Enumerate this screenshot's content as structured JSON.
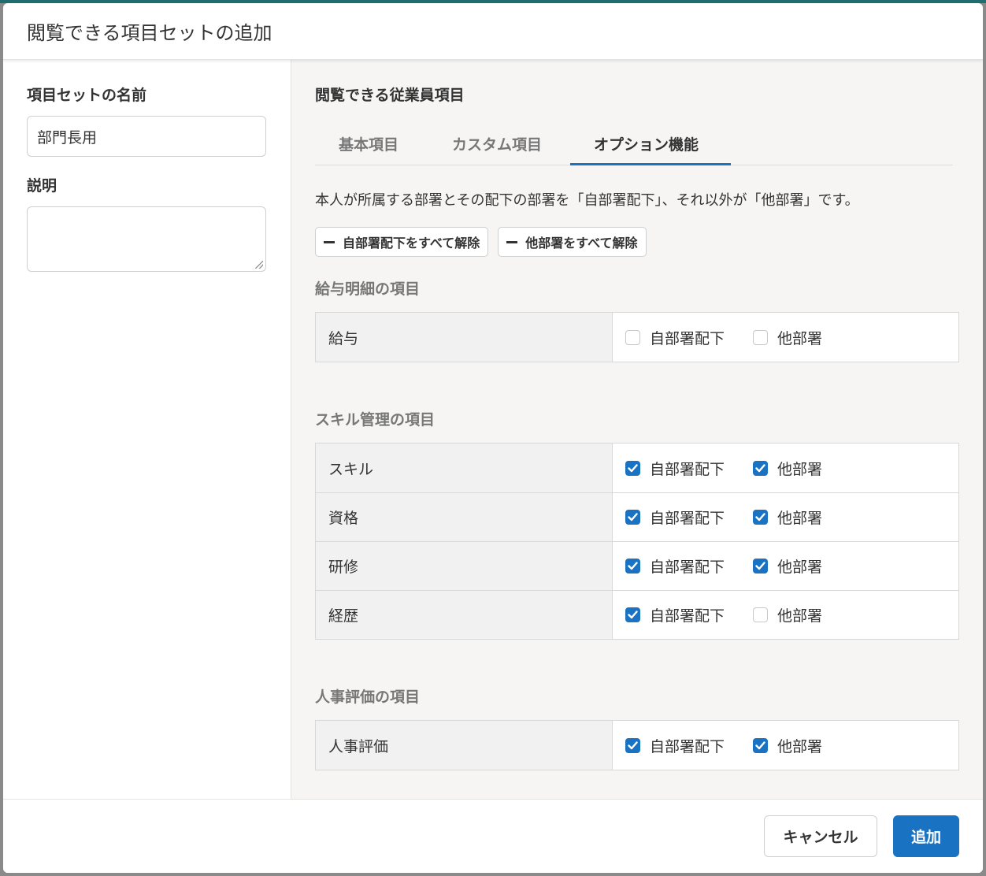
{
  "modal": {
    "title": "閲覧できる項目セットの追加"
  },
  "left": {
    "name_label": "項目セットの名前",
    "name_value": "部門長用",
    "desc_label": "説明",
    "desc_value": ""
  },
  "right": {
    "heading": "閲覧できる従業員項目",
    "tabs": [
      {
        "label": "基本項目",
        "active": false
      },
      {
        "label": "カスタム項目",
        "active": false
      },
      {
        "label": "オプション機能",
        "active": true
      }
    ],
    "description": "本人が所属する部署とその配下の部署を「自部署配下」、それ以外が「他部署」です。",
    "clear_own_label": "自部署配下をすべて解除",
    "clear_other_label": "他部署をすべて解除",
    "own_label": "自部署配下",
    "other_label": "他部署",
    "groups": [
      {
        "title": "給与明細の項目",
        "rows": [
          {
            "name": "給与",
            "own": false,
            "other": false
          }
        ]
      },
      {
        "title": "スキル管理の項目",
        "rows": [
          {
            "name": "スキル",
            "own": true,
            "other": true
          },
          {
            "name": "資格",
            "own": true,
            "other": true
          },
          {
            "name": "研修",
            "own": true,
            "other": true
          },
          {
            "name": "経歴",
            "own": true,
            "other": false
          }
        ]
      },
      {
        "title": "人事評価の項目",
        "rows": [
          {
            "name": "人事評価",
            "own": true,
            "other": true
          }
        ]
      }
    ]
  },
  "footer": {
    "cancel_label": "キャンセル",
    "add_label": "追加"
  },
  "colors": {
    "accent": "#1a73c2",
    "header_accent": "#1f6e6e"
  }
}
